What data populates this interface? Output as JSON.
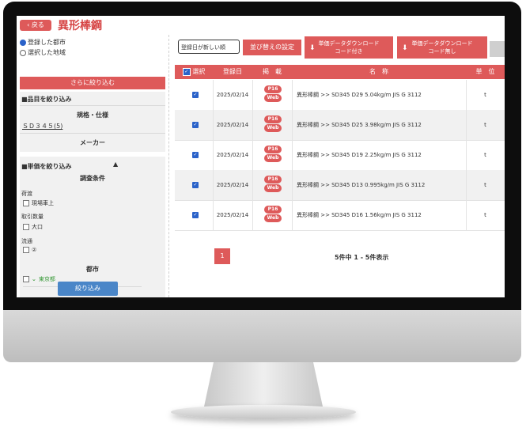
{
  "header": {
    "back_label": "戻る",
    "title": "異形棒鋼"
  },
  "sidebar": {
    "radio_registered": "登録した都市",
    "radio_selected": "選択した地域",
    "narrow_button": "さらに絞り込む",
    "item_filter_title": "■品目を絞り込み",
    "spec_label": "規格・仕様",
    "spec_link": "ＳＤ３４５(5)",
    "maker_label": "メーカー",
    "price_filter_title": "■単価を絞り込み",
    "survey_label": "調査条件",
    "delivery_label": "荷渡",
    "delivery_option": "現場車上",
    "quantity_label": "取引数量",
    "quantity_option": "大口",
    "distribution_label": "流通",
    "distribution_option": "②",
    "city_label": "都市",
    "city_option": "東京都",
    "apply_button": "絞り込み"
  },
  "toolbar": {
    "sort_select_value": "登録日が新しい順",
    "sort_button": "並び替えの設定",
    "dl_with_code_line1": "単価データダウンロード",
    "dl_with_code_line2": "コード付き",
    "dl_no_code_line1": "単価データダウンロード",
    "dl_no_code_line2": "コード無し"
  },
  "table": {
    "headers": {
      "select": "選択",
      "date": "登録日",
      "listing": "掲　載",
      "name": "名　称",
      "unit": "単　位"
    },
    "rows": [
      {
        "date": "2025/02/14",
        "badge1": "P16",
        "badge2": "Web",
        "name": "異形棒鋼 >> SD345 D29 5.04kg/m JIS G 3112",
        "unit": "t"
      },
      {
        "date": "2025/02/14",
        "badge1": "P16",
        "badge2": "Web",
        "name": "異形棒鋼 >> SD345 D25 3.98kg/m JIS G 3112",
        "unit": "t"
      },
      {
        "date": "2025/02/14",
        "badge1": "P16",
        "badge2": "Web",
        "name": "異形棒鋼 >> SD345 D19 2.25kg/m JIS G 3112",
        "unit": "t"
      },
      {
        "date": "2025/02/14",
        "badge1": "P16",
        "badge2": "Web",
        "name": "異形棒鋼 >> SD345 D13 0.995kg/m JIS G 3112",
        "unit": "t"
      },
      {
        "date": "2025/02/14",
        "badge1": "P16",
        "badge2": "Web",
        "name": "異形棒鋼 >> SD345 D16 1.56kg/m JIS G 3112",
        "unit": "t"
      }
    ]
  },
  "pagination": {
    "page": "1",
    "count_text": "5件中 1 - 5件表示"
  },
  "colors": {
    "accent": "#de5a5a",
    "title": "#d64545",
    "apply": "#4a86c8",
    "check": "#2a62c9"
  }
}
